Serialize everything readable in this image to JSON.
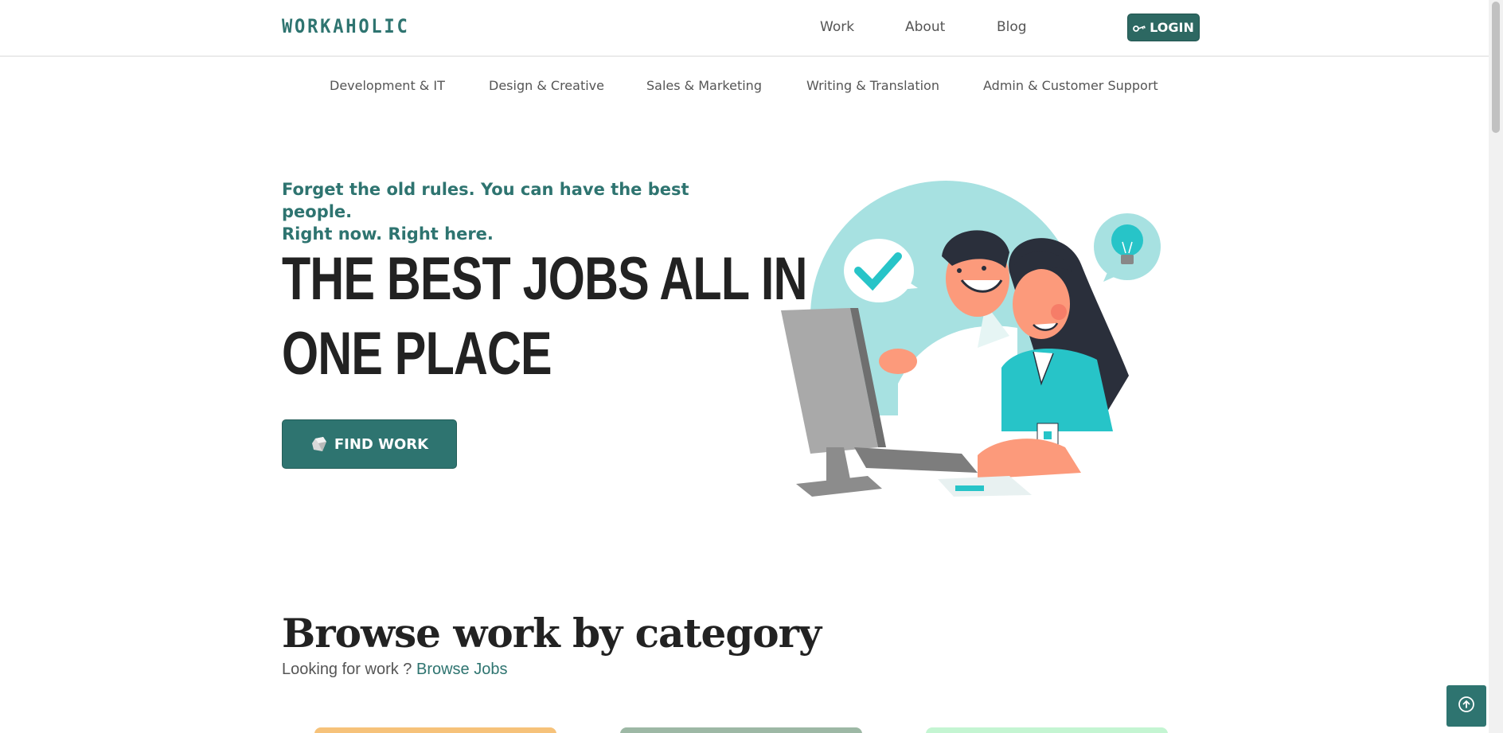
{
  "header": {
    "logo": "WORKAHOLIC",
    "nav": [
      {
        "label": "Work"
      },
      {
        "label": "About"
      },
      {
        "label": "Blog"
      }
    ],
    "login_label": "LOGIN"
  },
  "categories": [
    {
      "label": "Development & IT"
    },
    {
      "label": "Design & Creative"
    },
    {
      "label": "Sales & Marketing"
    },
    {
      "label": "Writing & Translation"
    },
    {
      "label": "Admin & Customer Support"
    }
  ],
  "hero": {
    "tagline_line1": "Forget the old rules. You can have the best people.",
    "tagline_line2": "Right now. Right here.",
    "headline_line1": "THE BEST JOBS ALL IN",
    "headline_line2": "ONE PLACE",
    "find_work_label": "FIND WORK"
  },
  "browse": {
    "title": "Browse work by category",
    "subtitle": "Looking for work ?",
    "link_label": "Browse Jobs"
  },
  "colors": {
    "brand": "#2e7470",
    "card_1": "#f6c27a",
    "card_2": "#9db8a5",
    "card_3": "#c4f5d2"
  },
  "icons": {
    "login": "key-icon",
    "find_work": "gem-icon",
    "scroll_top": "arrow-up-circle-icon"
  }
}
